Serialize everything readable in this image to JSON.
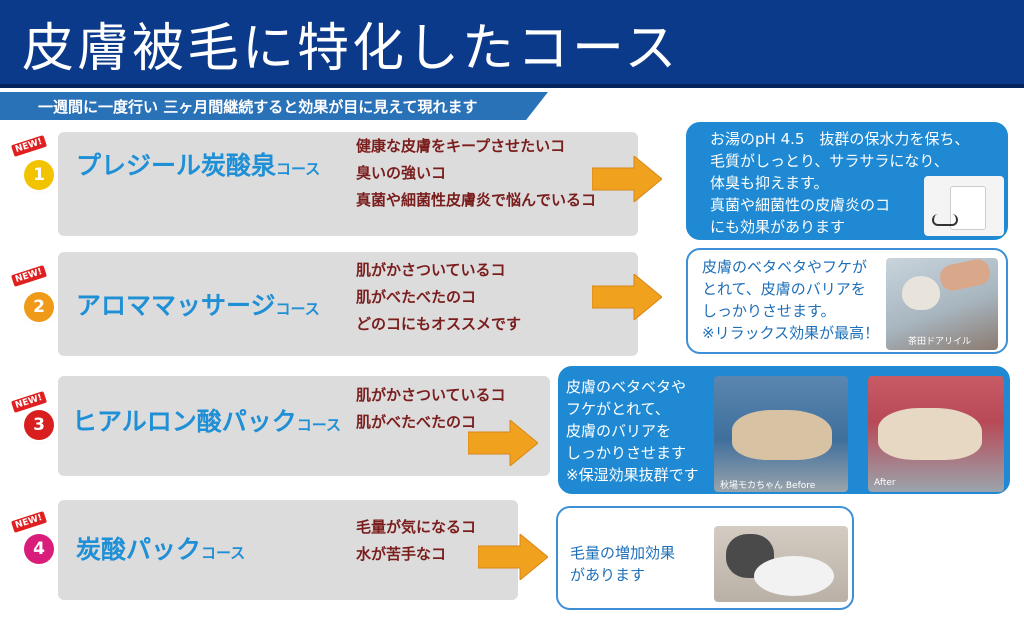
{
  "header": {
    "title": "皮膚被毛に特化したコース"
  },
  "subtitle": "一週間に一度行い 三ヶ月間継続すると効果が目に見えて現れます",
  "new_label": "NEW!",
  "courses": [
    {
      "number": "1",
      "name": "プレジール炭酸泉",
      "suffix": "コース",
      "badge_color": "#f2c300",
      "symptoms": [
        "健康な皮膚をキープさせたいコ",
        "臭いの強いコ",
        "真菌や細菌性皮膚炎で悩んでいるコ"
      ],
      "effect": [
        "お湯のpH 4.5　抜群の保水力を保ち、",
        "毛質がしっとり、サラサラになり、",
        "体臭も抑えます。",
        "真菌や細菌性の皮膚炎のコ",
        "にも効果があります"
      ]
    },
    {
      "number": "2",
      "name": "アロママッサージ",
      "suffix": "コース",
      "badge_color": "#f09a1a",
      "symptoms": [
        "肌がかさついているコ",
        "肌がべたべたのコ",
        "どのコにもオススメです"
      ],
      "effect": [
        "皮膚のベタベタやフケが",
        "とれて、皮膚のバリアを",
        "しっかりさせます。",
        "※リラックス効果が最高！"
      ],
      "photo_caption": "茶田ドアリイル"
    },
    {
      "number": "3",
      "name": "ヒアルロン酸パック",
      "suffix": "コース",
      "badge_color": "#d81e1e",
      "symptoms": [
        "肌がかさついているコ",
        "肌がべたべたのコ"
      ],
      "effect": [
        "皮膚のベタベタや",
        "フケがとれて、",
        "皮膚のバリアを",
        "しっかりさせます",
        "※保湿効果抜群です"
      ],
      "before_caption": "秋場モカちゃん Before",
      "after_caption": "After"
    },
    {
      "number": "4",
      "name": "炭酸パック",
      "suffix": "コース",
      "badge_color": "#d81e7a",
      "symptoms": [
        "毛量が気になるコ",
        "水が苦手なコ"
      ],
      "effect": [
        "毛量の増加効果",
        "があります"
      ]
    }
  ]
}
